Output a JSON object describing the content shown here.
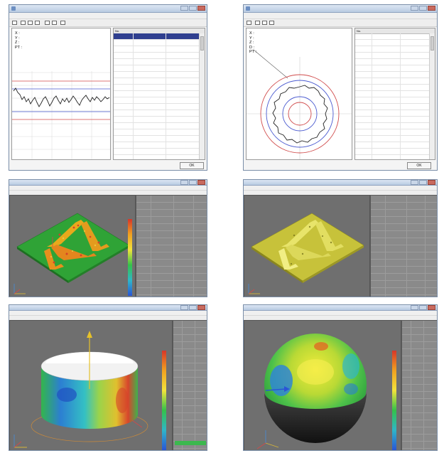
{
  "windows": {
    "w1": {
      "ok_label": "OK",
      "stats": "X :\nY :\nZ :\nPT :",
      "column_no": "No."
    },
    "w2": {
      "ok_label": "OK",
      "stats": "X :\nY :\nZ :\nD :\nPT :",
      "column_no": "No."
    }
  },
  "colors": {
    "title_bar": "#b9cbe2",
    "selected_row": "#2f3f8f",
    "scene_bg": "#6f6f6f",
    "ref_line_red": "#d04a4a",
    "ref_line_blue": "#4a5ad0"
  },
  "icons": [
    "app-icon",
    "minimize-icon",
    "maximize-icon",
    "close-icon",
    "open-icon",
    "save-icon",
    "copy-icon",
    "print-icon",
    "axis-triad-icon",
    "color-scale-icon"
  ]
}
